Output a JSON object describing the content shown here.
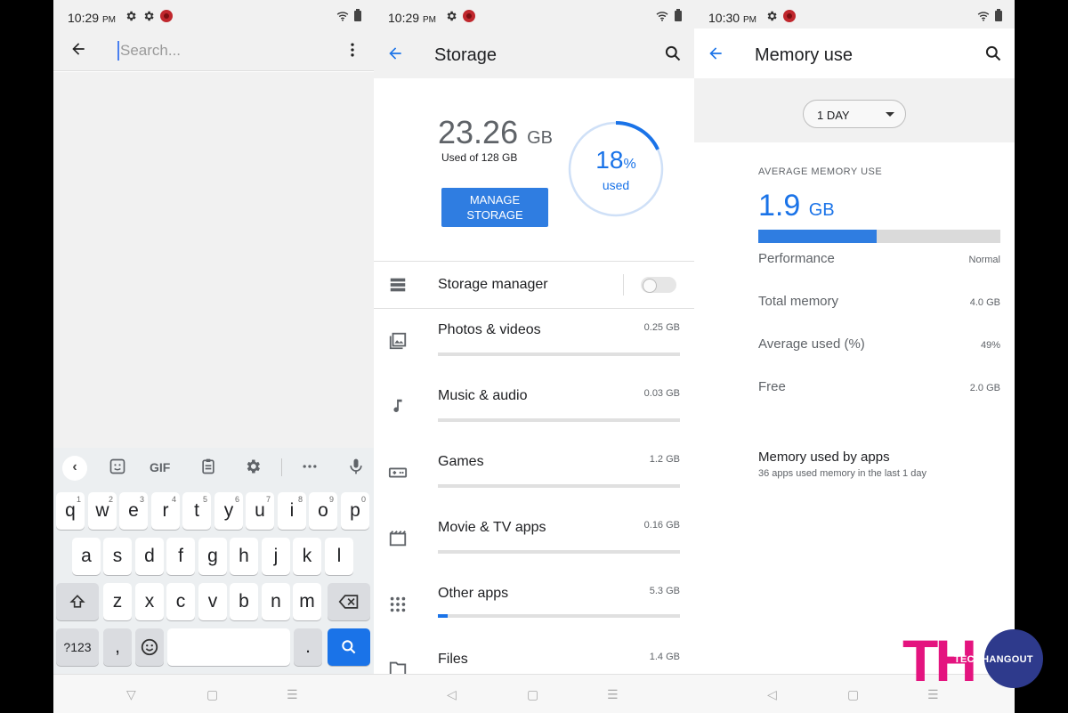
{
  "screen1": {
    "status": {
      "time": "10:29",
      "ampm": "PM"
    },
    "search_placeholder": "Search...",
    "keyboard": {
      "toolbar": {
        "gif": "GIF"
      },
      "row1": [
        {
          "k": "q",
          "s": "1"
        },
        {
          "k": "w",
          "s": "2"
        },
        {
          "k": "e",
          "s": "3"
        },
        {
          "k": "r",
          "s": "4"
        },
        {
          "k": "t",
          "s": "5"
        },
        {
          "k": "y",
          "s": "6"
        },
        {
          "k": "u",
          "s": "7"
        },
        {
          "k": "i",
          "s": "8"
        },
        {
          "k": "o",
          "s": "9"
        },
        {
          "k": "p",
          "s": "0"
        }
      ],
      "row2": [
        "a",
        "s",
        "d",
        "f",
        "g",
        "h",
        "j",
        "k",
        "l"
      ],
      "row3": [
        "z",
        "x",
        "c",
        "v",
        "b",
        "n",
        "m"
      ],
      "symbols_key": "?123",
      "comma": ",",
      "period": "."
    }
  },
  "screen2": {
    "status": {
      "time": "10:29",
      "ampm": "PM"
    },
    "title": "Storage",
    "used_value": "23.26",
    "used_unit": "GB",
    "used_of": "Used of 128 GB",
    "manage_line1": "MANAGE",
    "manage_line2": "STORAGE",
    "percent": "18",
    "percent_sign": "%",
    "percent_used": "used",
    "percent_fraction": 0.18,
    "storage_manager": "Storage manager",
    "categories": [
      {
        "label": "Photos & videos",
        "size": "0.25 GB",
        "fill": 0.0,
        "icon": "photos-icon"
      },
      {
        "label": "Music & audio",
        "size": "0.03 GB",
        "fill": 0.0,
        "icon": "music-icon"
      },
      {
        "label": "Games",
        "size": "1.2 GB",
        "fill": 0.0,
        "icon": "gamepad-icon"
      },
      {
        "label": "Movie & TV apps",
        "size": "0.16 GB",
        "fill": 0.0,
        "icon": "movie-icon"
      },
      {
        "label": "Other apps",
        "size": "5.3 GB",
        "fill": 0.04,
        "icon": "apps-grid-icon"
      },
      {
        "label": "Files",
        "size": "1.4 GB",
        "fill": 0.0,
        "icon": "folder-icon"
      }
    ],
    "accent": "#1a73e8"
  },
  "screen3": {
    "status": {
      "time": "10:30",
      "ampm": "PM"
    },
    "title": "Memory use",
    "period": "1 DAY",
    "avg_label": "AVERAGE MEMORY USE",
    "avg_value": "1.9",
    "avg_unit": "GB",
    "avg_fraction": 0.49,
    "rows": [
      {
        "label": "Performance",
        "value": "Normal"
      },
      {
        "label": "Total memory",
        "value": "4.0 GB"
      },
      {
        "label": "Average used (%)",
        "value": "49%"
      },
      {
        "label": "Free",
        "value": "2.0 GB"
      }
    ],
    "apps_title": "Memory used by apps",
    "apps_sub": "36 apps used memory in the last 1 day"
  },
  "watermark": {
    "logo": "TH",
    "text": "TECHHANGOUT"
  }
}
